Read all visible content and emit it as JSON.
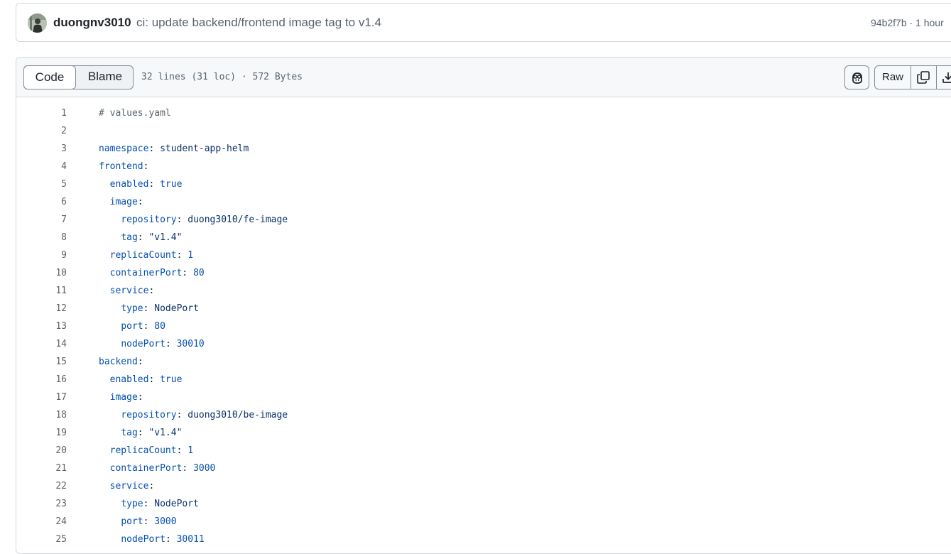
{
  "commit": {
    "author": "duongnv3010",
    "message": "ci: update backend/frontend image tag to v1.4",
    "meta": "94b2f7b · 1 hour"
  },
  "file_header": {
    "code_tab": "Code",
    "blame_tab": "Blame",
    "info": "32 lines (31 loc) · 572 Bytes",
    "raw_label": "Raw",
    "icons": [
      "copilot-icon",
      "copy-icon",
      "download-icon"
    ]
  },
  "code_lines": [
    {
      "num": "1",
      "indent": "",
      "comment": "# values.yaml"
    },
    {
      "num": "2",
      "indent": ""
    },
    {
      "num": "3",
      "indent": "",
      "key": "namespace",
      "value": "student-app-helm"
    },
    {
      "num": "4",
      "indent": "",
      "key": "frontend"
    },
    {
      "num": "5",
      "indent": "  ",
      "key": "enabled",
      "value": "true",
      "vtype": "n"
    },
    {
      "num": "6",
      "indent": "  ",
      "key": "image"
    },
    {
      "num": "7",
      "indent": "    ",
      "key": "repository",
      "value": "duong3010/fe-image"
    },
    {
      "num": "8",
      "indent": "    ",
      "key": "tag",
      "value": "\"v1.4\""
    },
    {
      "num": "9",
      "indent": "  ",
      "key": "replicaCount",
      "value": "1",
      "vtype": "n"
    },
    {
      "num": "10",
      "indent": "  ",
      "key": "containerPort",
      "value": "80",
      "vtype": "n"
    },
    {
      "num": "11",
      "indent": "  ",
      "key": "service"
    },
    {
      "num": "12",
      "indent": "    ",
      "key": "type",
      "value": "NodePort"
    },
    {
      "num": "13",
      "indent": "    ",
      "key": "port",
      "value": "80",
      "vtype": "n"
    },
    {
      "num": "14",
      "indent": "    ",
      "key": "nodePort",
      "value": "30010",
      "vtype": "n"
    },
    {
      "num": "15",
      "indent": "",
      "key": "backend"
    },
    {
      "num": "16",
      "indent": "  ",
      "key": "enabled",
      "value": "true",
      "vtype": "n"
    },
    {
      "num": "17",
      "indent": "  ",
      "key": "image"
    },
    {
      "num": "18",
      "indent": "    ",
      "key": "repository",
      "value": "duong3010/be-image"
    },
    {
      "num": "19",
      "indent": "    ",
      "key": "tag",
      "value": "\"v1.4\""
    },
    {
      "num": "20",
      "indent": "  ",
      "key": "replicaCount",
      "value": "1",
      "vtype": "n"
    },
    {
      "num": "21",
      "indent": "  ",
      "key": "containerPort",
      "value": "3000",
      "vtype": "n"
    },
    {
      "num": "22",
      "indent": "  ",
      "key": "service"
    },
    {
      "num": "23",
      "indent": "    ",
      "key": "type",
      "value": "NodePort"
    },
    {
      "num": "24",
      "indent": "    ",
      "key": "port",
      "value": "3000",
      "vtype": "n"
    },
    {
      "num": "25",
      "indent": "    ",
      "key": "nodePort",
      "value": "30011",
      "vtype": "n"
    }
  ],
  "colors": {
    "key": "#0550ae",
    "string": "#0a3069",
    "comment": "#59636e",
    "line_number": "#59636e"
  }
}
